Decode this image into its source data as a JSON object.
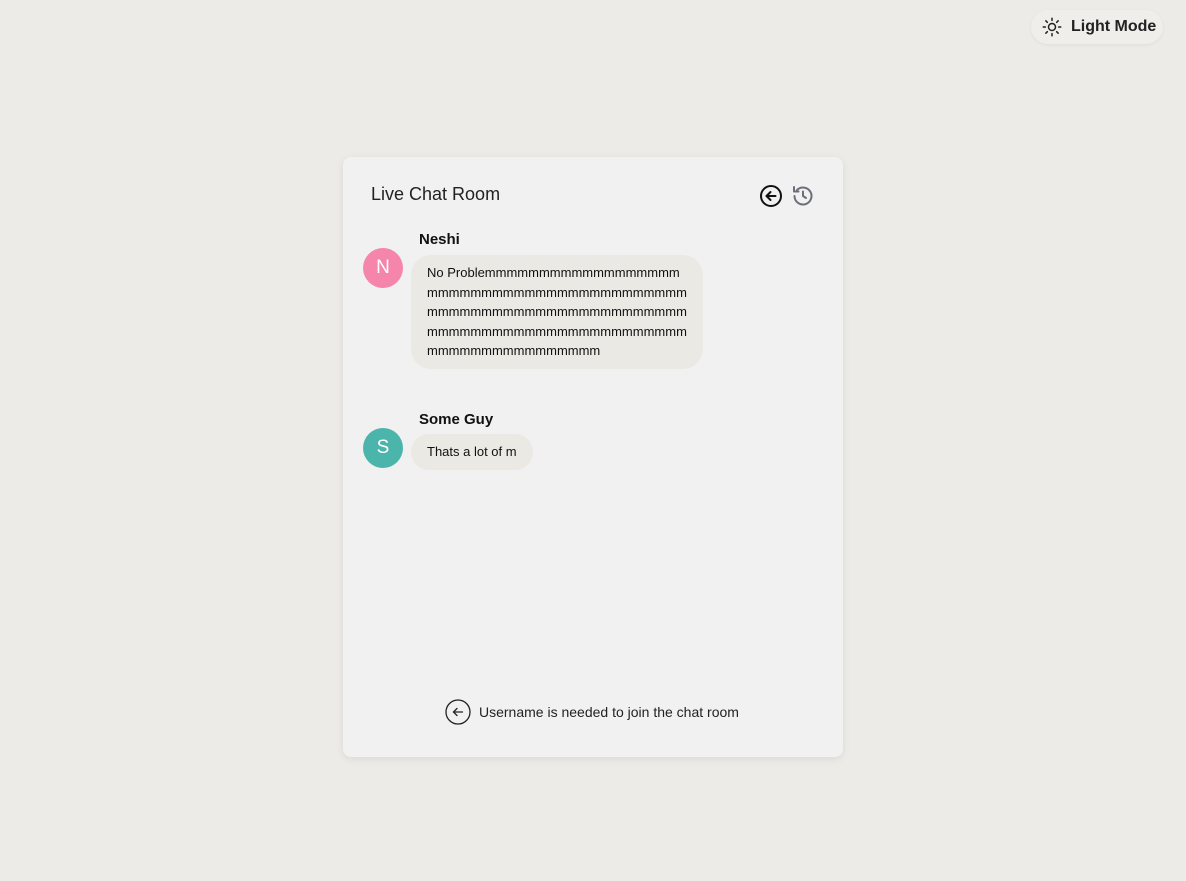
{
  "theme_toggle": {
    "label": "Light Mode",
    "icon": "sun-icon"
  },
  "chat": {
    "title": "Live Chat Room",
    "header_icons": [
      "back-arrow-circle-icon",
      "history-icon"
    ],
    "messages": [
      {
        "sender": "Neshi",
        "initial": "N",
        "avatar_color": "#f585aa",
        "text": "No Problemmmmmmmmmmmmmmmmmmmmmmmmmmmmmmmmmmmmmmmmmmmmmmmmmmmmmmmmmmmmmmmmmmmmmmmmmmmmmmmmmmmmmmmmmmmmmmmmmmmmmmmmmm"
      },
      {
        "sender": "Some Guy",
        "initial": "S",
        "avatar_color": "#4cb5ab",
        "text": "Thats a lot of m"
      }
    ],
    "footer": {
      "text": "Username is needed to join the chat room",
      "icon": "back-arrow-circle-icon"
    }
  },
  "colors": {
    "page_background": "#ecebe7",
    "card_background": "#f1f1f1",
    "bubble_background": "#ebe9e4"
  }
}
